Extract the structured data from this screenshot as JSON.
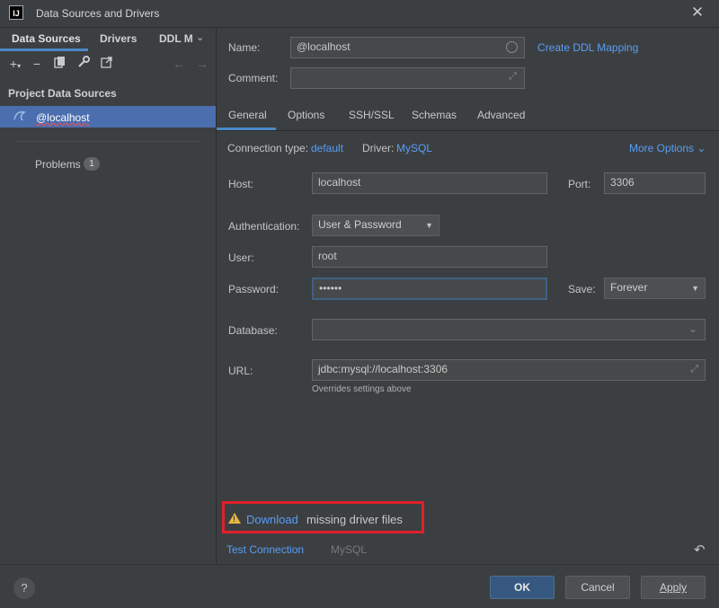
{
  "window": {
    "title": "Data Sources and Drivers",
    "logo_text": "IJ",
    "close_glyph": "✕"
  },
  "left": {
    "tabs": [
      "Data Sources",
      "Drivers",
      "DDL M"
    ],
    "tab_chevron": "⌄",
    "toolbar_icons": [
      "add-icon",
      "remove-icon",
      "duplicate-icon",
      "wrench-icon",
      "export-icon",
      "back-arrow-icon",
      "forward-arrow-icon"
    ],
    "project_heading": "Project Data Sources",
    "selected_item": "@localhost",
    "problems_label": "Problems",
    "problems_count": "1"
  },
  "form": {
    "name_label": "Name:",
    "name_value": "@localhost",
    "create_ddl_link": "Create DDL Mapping",
    "comment_label": "Comment:",
    "comment_value": ""
  },
  "tabs": [
    "General",
    "Options",
    "SSH/SSL",
    "Schemas",
    "Advanced"
  ],
  "general": {
    "conn_type_label": "Connection type:",
    "conn_type_value": "default",
    "driver_label": "Driver:",
    "driver_value": "MySQL",
    "more_options": "More Options ⌄",
    "host_label": "Host:",
    "host_value": "localhost",
    "port_label": "Port:",
    "port_value": "3306",
    "auth_label": "Authentication:",
    "auth_value": "User & Password",
    "user_label": "User:",
    "user_value": "root",
    "password_label": "Password:",
    "password_mask": "••••••",
    "save_label": "Save:",
    "save_value": "Forever",
    "database_label": "Database:",
    "database_value": "",
    "url_label": "URL:",
    "url_value": "jdbc:mysql://localhost:3306",
    "overrides_note": "Overrides settings above"
  },
  "warning": {
    "link": "Download",
    "rest": "missing driver files"
  },
  "footer": {
    "test_connection": "Test Connection",
    "driver_name": "MySQL"
  },
  "buttons": {
    "help": "?",
    "ok": "OK",
    "cancel": "Cancel",
    "apply": "Apply"
  },
  "colors": {
    "accent": "#4a88c7",
    "link": "#589df6",
    "selection": "#4b6eaf",
    "warning_border": "#e0202a"
  }
}
